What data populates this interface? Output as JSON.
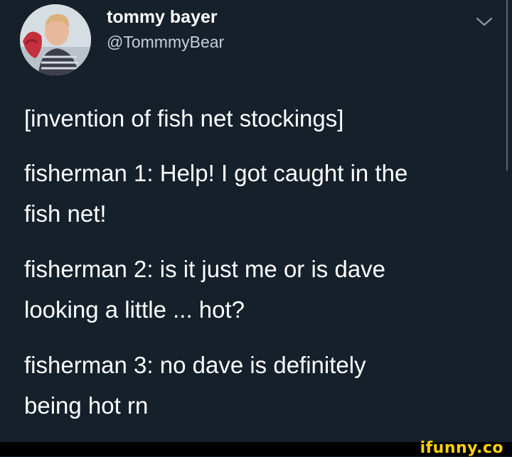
{
  "tweet": {
    "user_name": "tommy bayer",
    "user_handle": "@TommmyBear",
    "lines": [
      "[invention of fish net stockings]",
      "fisherman 1: Help! I got caught in the",
      "fish net!",
      "fisherman 2:  is it just me or is dave",
      "looking a little ... hot?",
      "fisherman 3: no dave is definitely",
      "being hot rn"
    ]
  },
  "icons": {
    "menu": "chevron-down-icon",
    "avatar": "avatar"
  },
  "watermark": {
    "text": "ifunny.co"
  },
  "colors": {
    "background": "#15202b",
    "text": "#ffffff",
    "handle": "#c7ced6",
    "watermark": "#ffd200"
  }
}
